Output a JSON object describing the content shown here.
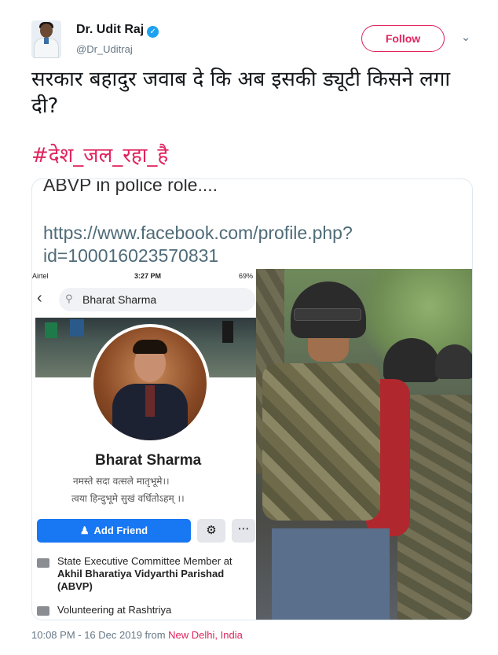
{
  "header": {
    "name": "Dr. Udit Raj",
    "handle": "@Dr_Uditraj",
    "follow_label": "Follow"
  },
  "tweet": {
    "text": "सरकार बहादुर जवाब दे कि अब इसकी ड्यूटी किसने लगा दी?",
    "hashtag": "#देश_जल_रहा_है"
  },
  "media": {
    "title": "ABVP in police role....",
    "url": "https://www.facebook.com/profile.php?id=100016023570831",
    "phone": {
      "carrier": "Airtel",
      "time": "3:27 PM",
      "battery": "69%",
      "search_value": "Bharat Sharma",
      "profile_name": "Bharat Sharma",
      "bio_line1": "नमस्ते सदा वत्सले मातृभूमे।।",
      "bio_line2": "त्वया हिन्दुभूमे सुखं वर्धितोऽहम् ।।",
      "add_friend_label": "Add Friend",
      "work_line1": "State Executive Committee Member at",
      "work_line2": "Akhil Bharatiya Vidyarthi Parishad",
      "work_line3": "(ABVP)",
      "work_line4": "Volunteering at Rashtriya"
    }
  },
  "footer": {
    "timestamp": "10:08 PM - 16 Dec 2019 from ",
    "location": "New Delhi, India"
  },
  "icons": [
    "verified-badge-icon",
    "chevron-down-icon",
    "back-arrow-icon",
    "search-icon",
    "add-person-icon",
    "gear-icon",
    "more-icon",
    "briefcase-icon"
  ],
  "colors": {
    "accent": "#e0245e",
    "verified": "#1da1f2",
    "facebook_blue": "#1877f2",
    "muted": "#657786"
  }
}
